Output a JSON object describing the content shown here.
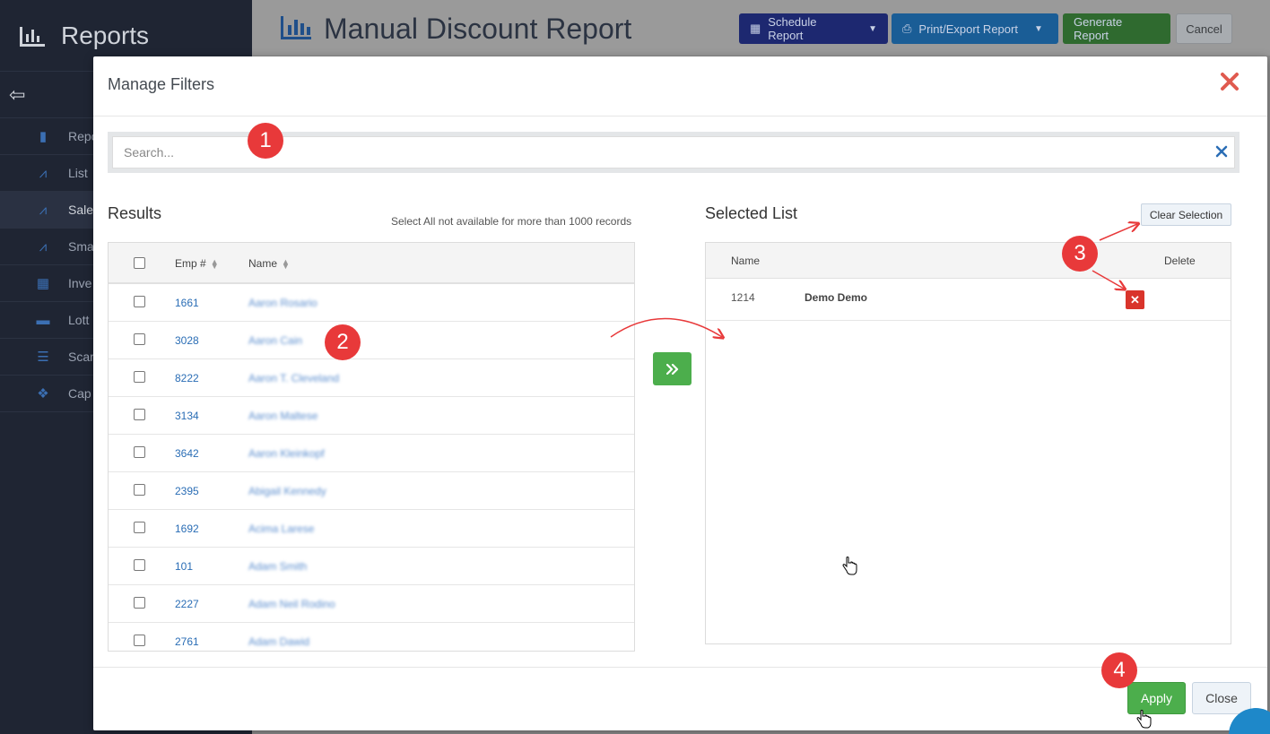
{
  "sidebar": {
    "title": "Reports",
    "items": [
      {
        "label": "Repo",
        "icon": "bookmark-icon"
      },
      {
        "label": "List",
        "icon": "line-chart-icon"
      },
      {
        "label": "Sale",
        "icon": "line-chart-icon"
      },
      {
        "label": "Sma",
        "icon": "line-chart-icon"
      },
      {
        "label": "Inve",
        "icon": "warehouse-icon"
      },
      {
        "label": "Lott",
        "icon": "ticket-icon"
      },
      {
        "label": "Scar",
        "icon": "list-icon"
      },
      {
        "label": "Cap",
        "icon": "cubes-icon"
      }
    ]
  },
  "header": {
    "title": "Manual Discount Report",
    "schedule_label": "Schedule Report",
    "print_label": "Print/Export Report",
    "generate_label": "Generate Report",
    "cancel_label": "Cancel"
  },
  "modal": {
    "title": "Manage Filters",
    "search": {
      "placeholder": "Search...",
      "value": ""
    },
    "results": {
      "title": "Results",
      "note": "Select All not available for more than 1000 records",
      "columns": [
        "Emp #",
        "Name"
      ],
      "rows": [
        {
          "emp": "1661",
          "name": "Aaron Rosario"
        },
        {
          "emp": "3028",
          "name": "Aaron Cain"
        },
        {
          "emp": "8222",
          "name": "Aaron T. Cleveland"
        },
        {
          "emp": "3134",
          "name": "Aaron Maltese"
        },
        {
          "emp": "3642",
          "name": "Aaron Kleinkopf"
        },
        {
          "emp": "2395",
          "name": "Abigail Kennedy"
        },
        {
          "emp": "1692",
          "name": "Acima Larese"
        },
        {
          "emp": "101",
          "name": "Adam Smith"
        },
        {
          "emp": "2227",
          "name": "Adam Neil Rodino"
        },
        {
          "emp": "2761",
          "name": "Adam Dawid"
        }
      ]
    },
    "selected": {
      "title": "Selected List",
      "clear_label": "Clear Selection",
      "columns": [
        "Name",
        "Delete"
      ],
      "rows": [
        {
          "emp": "1214",
          "name": "Demo Demo"
        }
      ]
    },
    "apply_label": "Apply",
    "close_label": "Close"
  },
  "callouts": [
    "1",
    "2",
    "3",
    "4"
  ],
  "colors": {
    "accent_green": "#4cae4c",
    "danger_red": "#d9342b",
    "callout_red": "#e8393a",
    "link_blue": "#2a6db5"
  }
}
